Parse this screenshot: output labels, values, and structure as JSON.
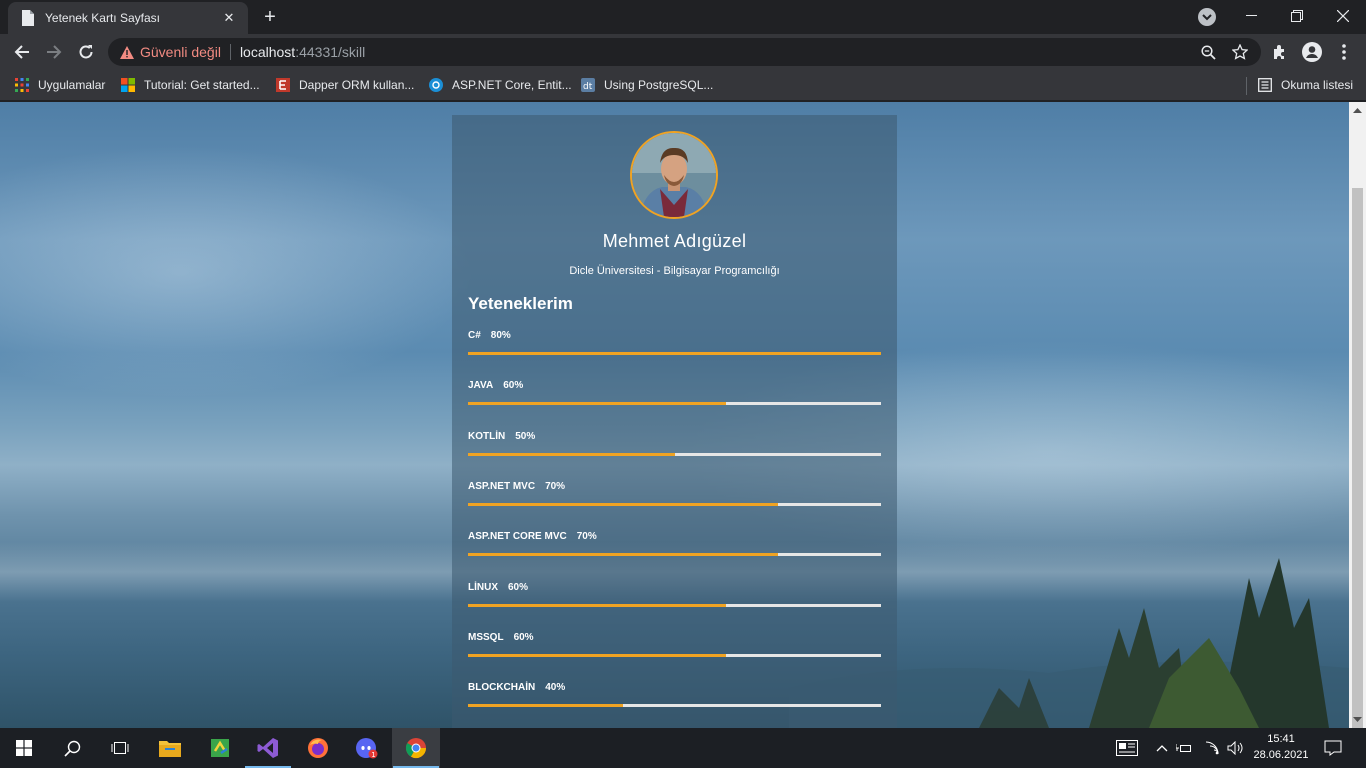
{
  "browser": {
    "tab_title": "Yetenek Kartı Sayfası",
    "new_tab": "+",
    "omnibox": {
      "security_label": "Güvenli değil",
      "url_host": "localhost",
      "url_rest": ":44331/skill"
    },
    "bookmarks": [
      "Uygulamalar",
      "Tutorial: Get started...",
      "Dapper ORM kullan...",
      "ASP.NET Core, Entit...",
      "Using PostgreSQL..."
    ],
    "reading_list": "Okuma listesi"
  },
  "profile": {
    "name": "Mehmet Adıgüzel",
    "school": "Dicle Üniversitesi - Bilgisayar Programcılığı",
    "skills_title": "Yeteneklerim"
  },
  "skills": [
    {
      "name": "C#",
      "percent_label": "80%",
      "value": 1.0
    },
    {
      "name": "JAVA",
      "percent_label": "60%",
      "value": 0.625
    },
    {
      "name": "KOTLİN",
      "percent_label": "50%",
      "value": 0.5
    },
    {
      "name": "ASP.NET MVC",
      "percent_label": "70%",
      "value": 0.75
    },
    {
      "name": "ASP.NET CORE MVC",
      "percent_label": "70%",
      "value": 0.75
    },
    {
      "name": "LİNUX",
      "percent_label": "60%",
      "value": 0.625
    },
    {
      "name": "MSSQL",
      "percent_label": "60%",
      "value": 0.625
    },
    {
      "name": "BLOCKCHAİN",
      "percent_label": "40%",
      "value": 0.375
    }
  ],
  "taskbar": {
    "time": "15:41",
    "date": "28.06.2021",
    "apps": [
      "windows-start",
      "search",
      "task-view",
      "file-explorer",
      "visual-studio-code",
      "visual-studio",
      "firefox",
      "discord",
      "chrome"
    ]
  },
  "colors": {
    "accent": "#f0a323",
    "track": "#e6e6e6",
    "card_bg": "rgba(60,90,112,0.55)"
  }
}
